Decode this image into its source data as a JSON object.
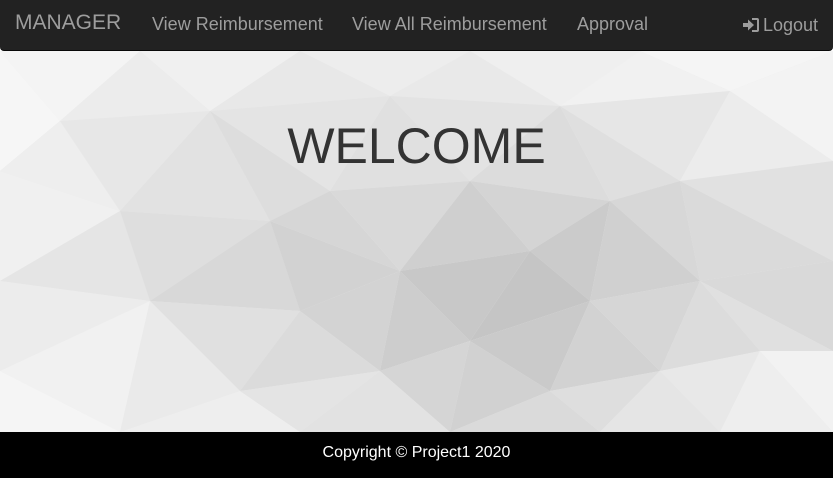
{
  "navbar": {
    "brand": "MANAGER",
    "links": [
      {
        "label": "View Reimbursement"
      },
      {
        "label": "View All Reimbursement"
      },
      {
        "label": "Approval"
      }
    ],
    "logout_label": "Logout",
    "logout_icon": "sign-in-icon"
  },
  "hero": {
    "title": "WELCOME"
  },
  "footer": {
    "copyright": "Copyright © Project1 2020"
  },
  "colors": {
    "navbar_bg": "#222222",
    "nav_text": "#9d9d9d",
    "title_text": "#333333",
    "footer_bg": "#000000",
    "footer_text": "#ffffff"
  }
}
